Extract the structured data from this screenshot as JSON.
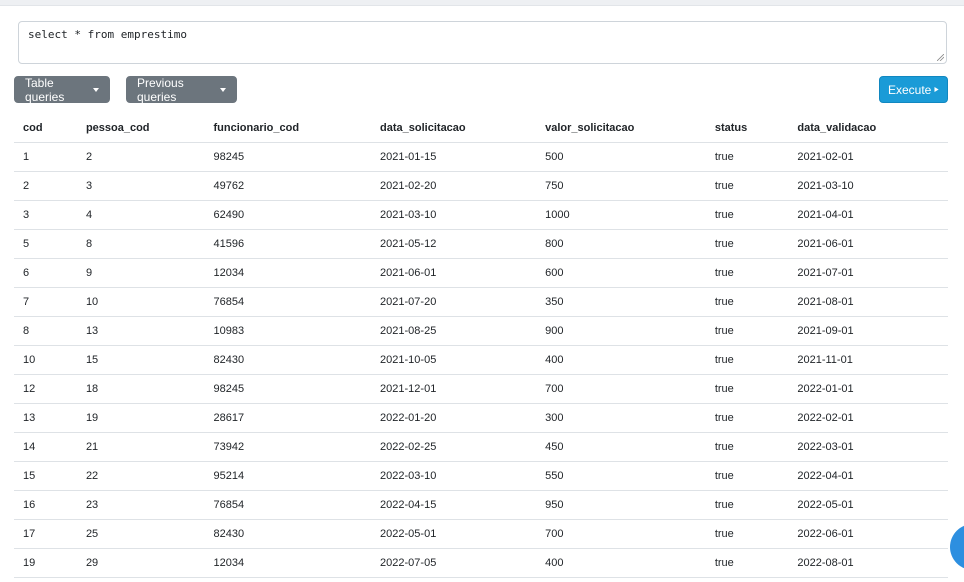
{
  "query": {
    "text": "select * from emprestimo"
  },
  "toolbar": {
    "table_queries_label": "Table queries",
    "previous_queries_label": "Previous queries",
    "execute_label": "Execute"
  },
  "colors": {
    "gray_button": "#6c757d",
    "execute_button": "#1a9bd7",
    "fab": "#2d8fe0"
  },
  "icons": {
    "execute": "play-icon",
    "dropdown": "caret-down-icon"
  },
  "results": {
    "columns": [
      "cod",
      "pessoa_cod",
      "funcionario_cod",
      "data_solicitacao",
      "valor_solicitacao",
      "status",
      "data_validacao"
    ],
    "rows": [
      [
        "1",
        "2",
        "98245",
        "2021-01-15",
        "500",
        "true",
        "2021-02-01"
      ],
      [
        "2",
        "3",
        "49762",
        "2021-02-20",
        "750",
        "true",
        "2021-03-10"
      ],
      [
        "3",
        "4",
        "62490",
        "2021-03-10",
        "1000",
        "true",
        "2021-04-01"
      ],
      [
        "5",
        "8",
        "41596",
        "2021-05-12",
        "800",
        "true",
        "2021-06-01"
      ],
      [
        "6",
        "9",
        "12034",
        "2021-06-01",
        "600",
        "true",
        "2021-07-01"
      ],
      [
        "7",
        "10",
        "76854",
        "2021-07-20",
        "350",
        "true",
        "2021-08-01"
      ],
      [
        "8",
        "13",
        "10983",
        "2021-08-25",
        "900",
        "true",
        "2021-09-01"
      ],
      [
        "10",
        "15",
        "82430",
        "2021-10-05",
        "400",
        "true",
        "2021-11-01"
      ],
      [
        "12",
        "18",
        "98245",
        "2021-12-01",
        "700",
        "true",
        "2022-01-01"
      ],
      [
        "13",
        "19",
        "28617",
        "2022-01-20",
        "300",
        "true",
        "2022-02-01"
      ],
      [
        "14",
        "21",
        "73942",
        "2022-02-25",
        "450",
        "true",
        "2022-03-01"
      ],
      [
        "15",
        "22",
        "95214",
        "2022-03-10",
        "550",
        "true",
        "2022-04-01"
      ],
      [
        "16",
        "23",
        "76854",
        "2022-04-15",
        "950",
        "true",
        "2022-05-01"
      ],
      [
        "17",
        "25",
        "82430",
        "2022-05-01",
        "700",
        "true",
        "2022-06-01"
      ],
      [
        "19",
        "29",
        "12034",
        "2022-07-05",
        "400",
        "true",
        "2022-08-01"
      ]
    ]
  }
}
